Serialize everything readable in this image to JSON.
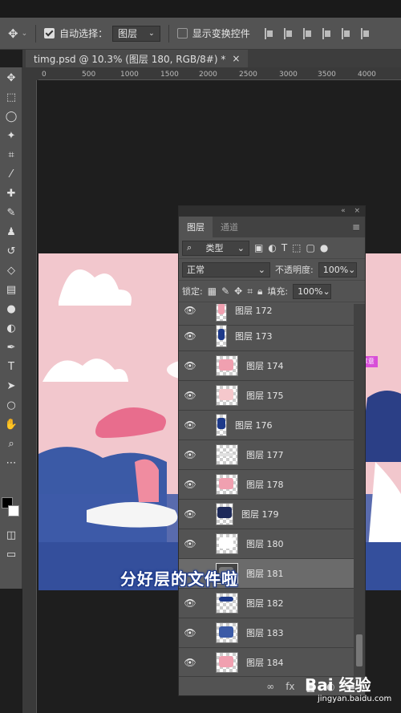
{
  "options_bar": {
    "auto_select_label": "自动选择：",
    "auto_select_value": "图层",
    "show_transform_label": "显示变换控件"
  },
  "document_tab": {
    "title": "timg.psd @ 10.3% (图层 180, RGB/8#) *",
    "close": "×"
  },
  "ruler": {
    "ticks": [
      "0",
      "500",
      "1000",
      "1500",
      "2000",
      "2500",
      "3000",
      "3500",
      "4000"
    ]
  },
  "layers_panel": {
    "header_collapse": "«",
    "header_close": "×",
    "tabs": [
      "图层",
      "通道"
    ],
    "filter_label": "类型",
    "blend_mode": "正常",
    "opacity_label": "不透明度:",
    "opacity_value": "100%",
    "lock_label": "锁定:",
    "fill_label": "填充:",
    "fill_value": "100%",
    "layers": [
      {
        "name": "图层 172",
        "visible": true,
        "selected": false
      },
      {
        "name": "图层 173",
        "visible": true,
        "selected": false
      },
      {
        "name": "图层 174",
        "visible": true,
        "selected": false
      },
      {
        "name": "图层 175",
        "visible": true,
        "selected": false
      },
      {
        "name": "图层 176",
        "visible": true,
        "selected": false
      },
      {
        "name": "图层 177",
        "visible": true,
        "selected": false
      },
      {
        "name": "图层 178",
        "visible": true,
        "selected": false
      },
      {
        "name": "图层 179",
        "visible": true,
        "selected": false
      },
      {
        "name": "图层 180",
        "visible": true,
        "selected": false
      },
      {
        "name": "图层 181",
        "visible": false,
        "selected": true
      },
      {
        "name": "图层 182",
        "visible": true,
        "selected": false
      },
      {
        "name": "图层 183",
        "visible": true,
        "selected": false
      },
      {
        "name": "图层 184",
        "visible": true,
        "selected": false
      }
    ],
    "bottom_fx": "fx"
  },
  "canvas_tag": "79 拿意",
  "subtitle": "分好层的文件啦",
  "watermark": {
    "logo": "Bai 经验",
    "url": "jingyan.baidu.com"
  },
  "colors": {
    "canvas_pink": "#f2c7cd",
    "navy": "#1e3a8a",
    "selection_tag": "#d84fd8"
  }
}
